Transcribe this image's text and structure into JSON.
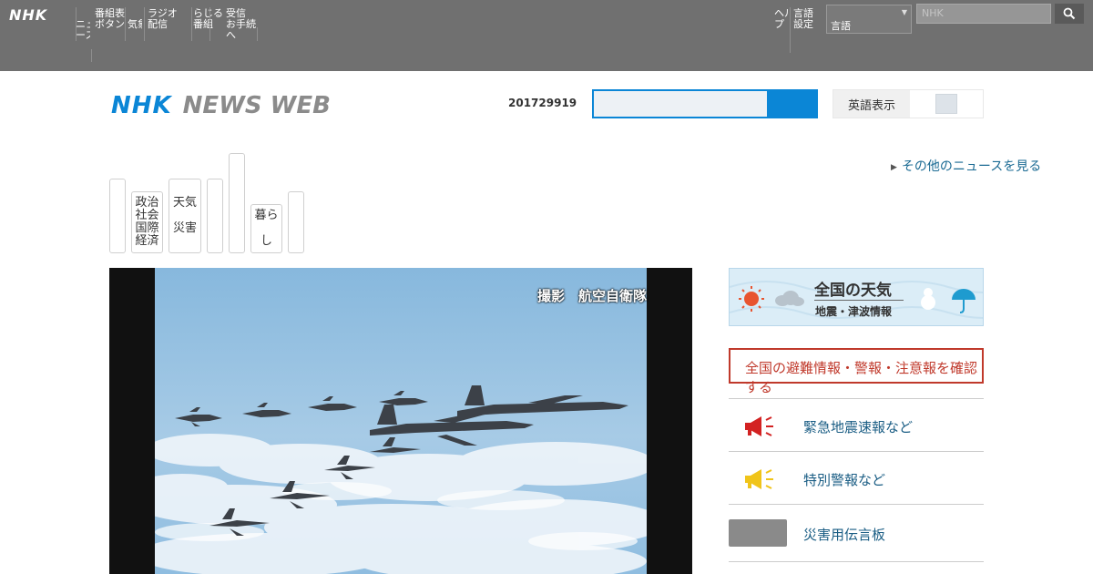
{
  "global_nav": {
    "logo": "NHK",
    "items": [
      "ニュ\nース",
      "番組表\nボタン",
      "気象",
      "ラジオ\n配信",
      "らじる\n番組",
      "受信\nお手続き\nへ"
    ],
    "right_items": [
      "ヘル\nプ",
      "言語\n設定"
    ],
    "select_value": "言語",
    "search_placeholder": "NHK"
  },
  "header": {
    "logo_nhk": "NHK",
    "logo_news": "NEWS WEB",
    "date": "201729919",
    "search_value": "",
    "lang_label": "英語表示"
  },
  "top_link": "その他のニュースを見る",
  "tabs": [
    "",
    "政治\n社会\n国際\n経済",
    "天気\n\n災害",
    "",
    "",
    "暮ら\n\nし",
    ""
  ],
  "hero": {
    "caption": "撮影　航空自衛隊"
  },
  "sidebar": {
    "weather_title": "全国の天気",
    "weather_sub": "地震・津波情報",
    "alert_text": "全国の避難情報・警報・注意報を確認する",
    "rows": [
      {
        "icon": "megaphone-red-icon",
        "text": "緊急地震速報など"
      },
      {
        "icon": "megaphone-yellow-icon",
        "text": "特別警報など"
      },
      {
        "icon": "gray-image",
        "text": "災害用伝言板"
      }
    ]
  },
  "colors": {
    "global_bar": "#707070",
    "brand_blue": "#0b86d6",
    "link_blue": "#1a6a93",
    "alert_red": "#c0392b"
  }
}
